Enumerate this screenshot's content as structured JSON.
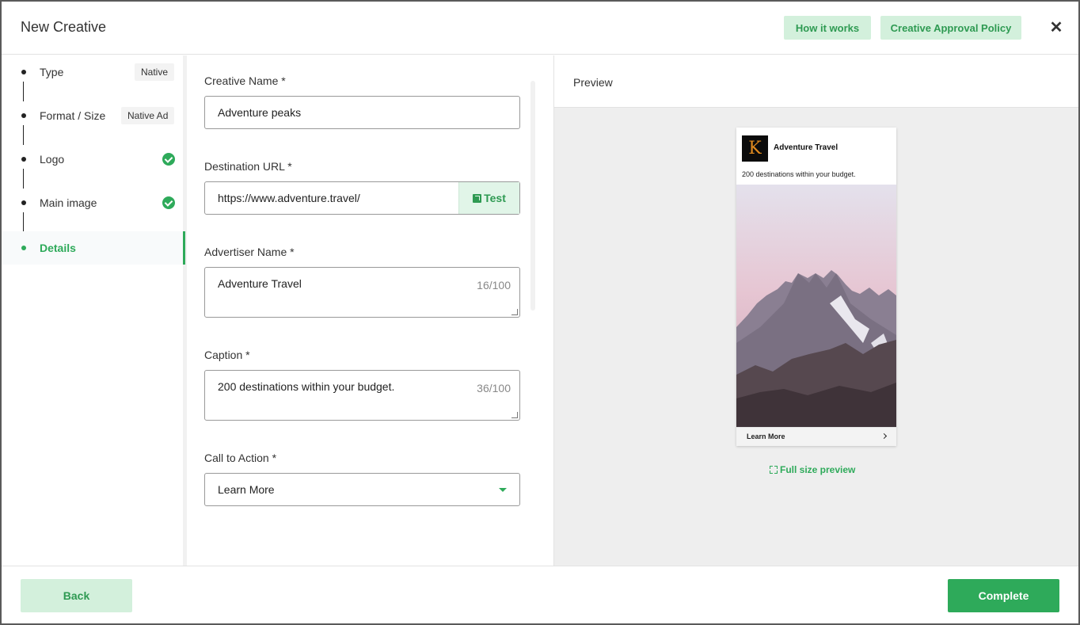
{
  "modal": {
    "title": "New Creative",
    "how_it_works": "How it works",
    "approval_policy": "Creative Approval Policy",
    "close_glyph": "✕"
  },
  "steps": [
    {
      "label": "Type",
      "badge": "Native",
      "status": "done"
    },
    {
      "label": "Format / Size",
      "badge": "Native Ad",
      "status": "done"
    },
    {
      "label": "Logo",
      "badge": "",
      "status": "checked"
    },
    {
      "label": "Main image",
      "badge": "",
      "status": "checked"
    },
    {
      "label": "Details",
      "badge": "",
      "status": "active"
    }
  ],
  "form": {
    "creative_name_label": "Creative Name *",
    "creative_name_value": "Adventure peaks",
    "destination_url_label": "Destination URL *",
    "destination_url_value": "https://www.adventure.travel/",
    "test_label": "Test",
    "advertiser_name_label": "Advertiser Name *",
    "advertiser_name_value": "Adventure Travel",
    "advertiser_counter": "16/100",
    "caption_label": "Caption *",
    "caption_value": "200 destinations within your budget.",
    "caption_counter": "36/100",
    "cta_label": "Call to Action *",
    "cta_value": "Learn More"
  },
  "preview": {
    "title": "Preview",
    "logo_letter": "K",
    "advertiser": "Adventure Travel",
    "caption": "200 destinations within your budget.",
    "cta": "Learn More",
    "full_size": "Full size preview"
  },
  "footer": {
    "back": "Back",
    "complete": "Complete"
  },
  "colors": {
    "accent": "#2eaa5a",
    "accent_light": "#d3f0dc"
  }
}
